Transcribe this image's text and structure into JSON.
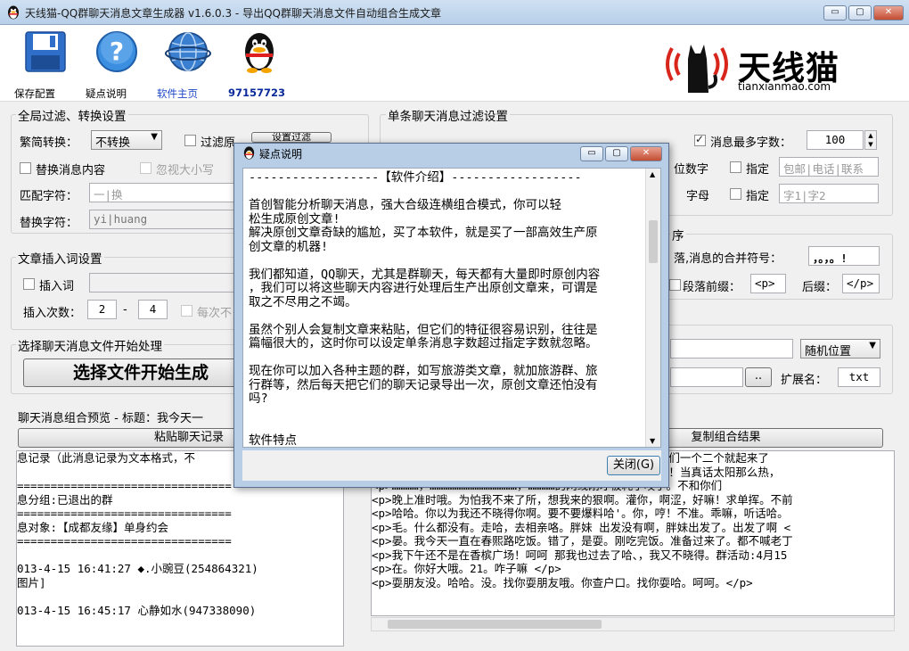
{
  "window": {
    "title": "天线猫-QQ群聊天消息文章生成器 v1.6.0.3 - 导出QQ群聊天消息文件自动组合生成文章",
    "min": "▭",
    "max": "▢",
    "close": "✕"
  },
  "toolbar": {
    "save": "保存配置",
    "help": "疑点说明",
    "home": "软件主页",
    "qq": "97157723"
  },
  "brand": {
    "title": "天线猫",
    "site": "tianxianmao.com"
  },
  "global": {
    "title": "全局过滤、转换设置",
    "trad_label": "繁简转换：",
    "trad_value": "不转换",
    "filter_label": "过滤原",
    "filter_btn": "设置过滤",
    "replace_label": "替换消息内容",
    "ignore_case": "忽视大小写",
    "match_label": "匹配字符：",
    "match_value": "一|换",
    "replace_with_label": "替换字符：",
    "replace_with_value": "yi|huang"
  },
  "single": {
    "title": "单条聊天消息过滤设置",
    "max_chars_label": "消息最多字数：",
    "max_chars_value": "100",
    "digits_label": "位数字",
    "specify1": "指定",
    "specify1_value": "包邮|电话|联系",
    "letters_label": "字母",
    "specify2": "指定",
    "specify2_value": "字1|字2"
  },
  "merge": {
    "title": "序",
    "sep_label": "落,消息的合并符号：",
    "sep_value": "，。，。!",
    "prefix_label": "段落前缀：",
    "prefix_value": "<p>",
    "suffix_label": "后缀：",
    "suffix_value": "</p>"
  },
  "insert": {
    "title": "文章插入词设置",
    "insert_word": "插入词",
    "times_label": "插入次数：",
    "min_value": "2",
    "dash": "-",
    "max_value": "4",
    "each": "每次不"
  },
  "process": {
    "title": "选择聊天消息文件开始处理",
    "start_btn": "选择文件开始生成",
    "position": "随机位置",
    "browse": "..",
    "ext_label": "扩展名：",
    "ext_value": "txt"
  },
  "preview": {
    "title": "聊天消息组合预览 - 标题：我今天一",
    "paste_btn": "粘贴聊天记录",
    "copy_btn": "复制组合结果",
    "left_lines": [
      "息记录（此消息记录为文本格式，不",
      "",
      "================================",
      "息分组:已退出的群",
      "================================",
      "息对象:【成都友缘】单身约会",
      "================================",
      "",
      "013-4-15 16:41:27 ◆.小豌豆(254864321)",
      "图片]",
      "",
      "013-4-15 16:45:17 心静如水(947338090)"
    ],
    "right_lines": [
      "                                    下班了，你们一个二个就起来了",
      "                                    。哎。还你！当真话太阳那么热，",
      "<p>…………，…………………………………，…………的网线刚才被耗子咬了。不和你们",
      "<p>晚上准时哦。为怕我不来了所，想我来的狠啊。灌你，啊涩，好嘛！求单挥。不前",
      "<p>哈哈。你以为我还不晓得你啊。要不要爆料哈'。你，哼！不准。乖嘛，听话哈。",
      "<p>毛。什么都没有。走哈，去相亲咯。胖妹 出发没有啊，胖妹出发了。出发了啊 <",
      "<p>晏。我今天一直在春熙路吃饭。错了，是耍。刚吃完饭。准备过来了。都不喊老丁",
      "<p>我下午还不是在香槟广场！呵呵 那我也过去了哈、，我又不晓得。群活动:4月15",
      "<p>在。你好大哦。21。咋子嘛 </p>",
      "<p>耍朋友没。哈哈。没。找你耍朋友哦。你查户口。找你耍哈。呵呵。</p>"
    ]
  },
  "dialog": {
    "title": "疑点说明",
    "close_btn": "关闭(G)",
    "lines": [
      "------------------【软件介绍】------------------",
      "",
      "首创智能分析聊天消息，强大合级连横组合模式，你可以轻",
      "松生成原创文章!",
      "解决原创文章奇缺的尴尬，买了本软件，就是买了一部高效生产原",
      "创文章的机器!",
      "",
      "我们都知道，QQ聊天，尤其是群聊天，每天都有大量即时原创内容",
      "，我们可以将这些聊天内容进行处理后生产出原创文章来，可谓是",
      "取之不尽用之不竭。",
      "",
      "虽然个别人会复制文章来粘贴，但它们的特征很容易识别，往往是",
      "篇幅很大的，这时你可以设定单条消息字数超过指定字数就忽略。",
      "",
      "现在你可以加入各种主题的群，如写旅游类文章，就加旅游群、旅",
      "行群等，然后每天把它们的聊天记录导出一次，原创文章还怕没有",
      "吗?",
      "",
      "",
      "软件特点"
    ]
  },
  "colors": {
    "brand_red": "#d8261c",
    "link_blue": "#1d48c8"
  }
}
